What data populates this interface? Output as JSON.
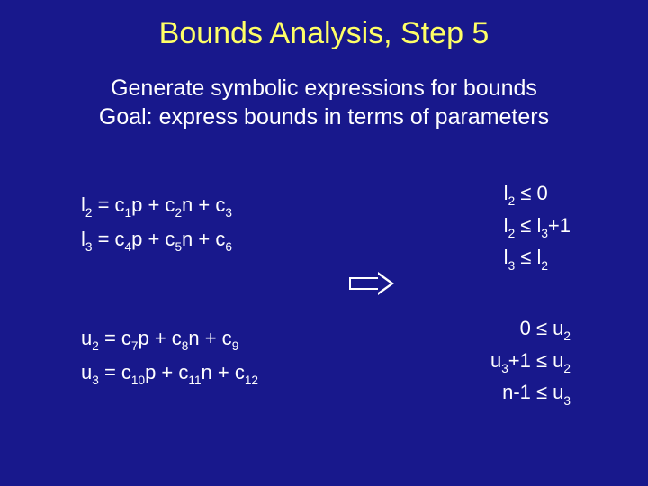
{
  "title": "Bounds Analysis, Step 5",
  "subtitle_line1": "Generate symbolic expressions for bounds",
  "subtitle_line2": "Goal: express bounds in terms of parameters",
  "equations": {
    "l2": {
      "lhs": "l",
      "lsub": "2",
      "c1": "1",
      "c2": "2",
      "c3": "3"
    },
    "l3": {
      "lhs": "l",
      "lsub": "3",
      "c1": "4",
      "c2": "5",
      "c3": "6"
    },
    "u2": {
      "lhs": "u",
      "lsub": "2",
      "c1": "7",
      "c2": "8",
      "c3": "9"
    },
    "u3": {
      "lhs": "u",
      "lsub": "3",
      "c1": "10",
      "c2": "11",
      "c3": "12"
    }
  },
  "constraints_top": [
    "l<sub>2</sub> ≤ 0",
    "l<sub>2</sub> ≤ l<sub>3</sub>+1",
    "l<sub>3</sub> ≤ l<sub>2</sub>"
  ],
  "constraints_bot": [
    "0 ≤ u<sub>2</sub>",
    "u<sub>3</sub>+1 ≤ u<sub>2</sub>",
    "n-1 ≤ u<sub>3</sub>"
  ]
}
